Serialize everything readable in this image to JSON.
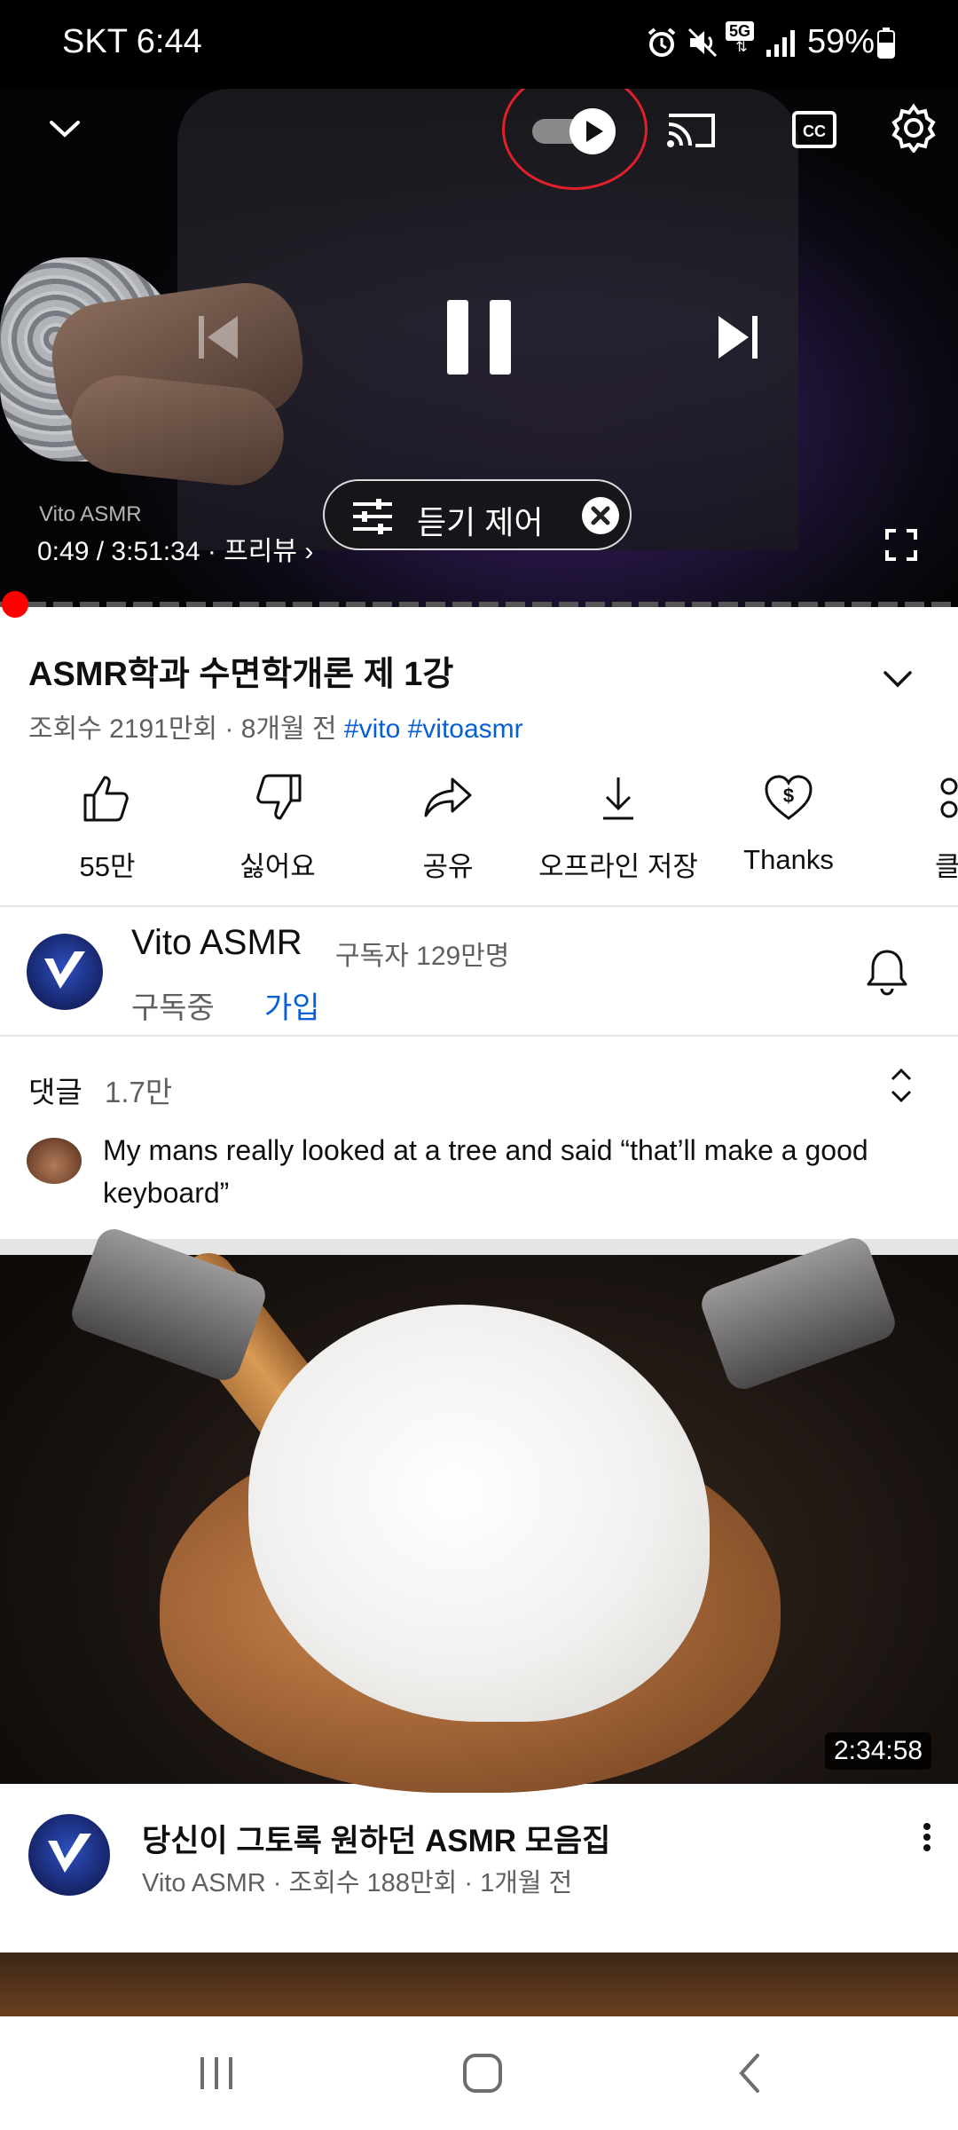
{
  "status_bar": {
    "carrier_time": "SKT 6:44",
    "network": "5G",
    "battery": "59%"
  },
  "player": {
    "listen_control_label": "듣기 제어",
    "watermark": "Vito ASMR",
    "time_current": "0:49",
    "time_total": "/ 3:51:34",
    "preview_label": "· 프리뷰",
    "progress": 0.004
  },
  "video": {
    "title": "ASMR학과 수면학개론 제 1강",
    "views": "조회수 2191만회 · 8개월 전",
    "tag1": "#vito",
    "tag2": "#vitoasmr"
  },
  "actions": {
    "like": "55만",
    "dislike": "싫어요",
    "share": "공유",
    "download": "오프라인 저장",
    "thanks": "Thanks",
    "clip": "클"
  },
  "channel": {
    "name": "Vito ASMR",
    "subscribers": "구독자 129만명",
    "subscribed": "구독중",
    "join": "가입"
  },
  "comments": {
    "label": "댓글",
    "count": "1.7만",
    "top_comment": "My mans really looked at a tree and said “that’ll make a good keyboard”"
  },
  "recommended": {
    "duration": "2:34:58",
    "title": "당신이 그토록 원하던 ASMR 모음집",
    "meta": "Vito ASMR · 조회수 188만회 · 1개월 전"
  }
}
